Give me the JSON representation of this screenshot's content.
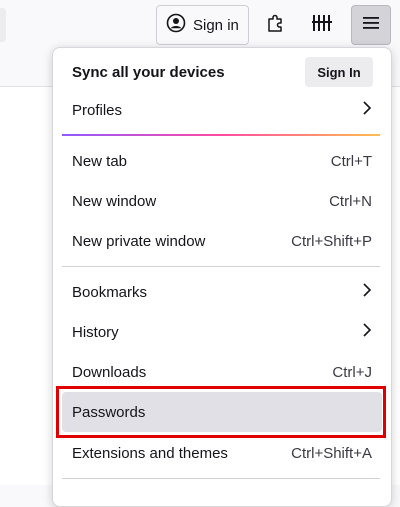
{
  "toolbar": {
    "sign_in_label": "Sign in",
    "icons": [
      "account-icon",
      "extensions-icon",
      "library-icon",
      "hamburger-menu-icon"
    ]
  },
  "menu": {
    "sync_title": "Sync all your devices",
    "sync_signin_label": "Sign In",
    "items": [
      {
        "label": "Profiles",
        "shortcut": "",
        "submenu": true
      },
      {
        "label": "New tab",
        "shortcut": "Ctrl+T"
      },
      {
        "label": "New window",
        "shortcut": "Ctrl+N"
      },
      {
        "label": "New private window",
        "shortcut": "Ctrl+Shift+P"
      },
      {
        "label": "Bookmarks",
        "shortcut": "",
        "submenu": true
      },
      {
        "label": "History",
        "shortcut": "",
        "submenu": true
      },
      {
        "label": "Downloads",
        "shortcut": "Ctrl+J"
      },
      {
        "label": "Passwords",
        "shortcut": "",
        "highlighted": true
      },
      {
        "label": "Extensions and themes",
        "shortcut": "Ctrl+Shift+A"
      }
    ]
  },
  "colors": {
    "highlight": "#e0e0e6",
    "focus_outline": "#e00000",
    "panel_background": "#ffffff"
  }
}
